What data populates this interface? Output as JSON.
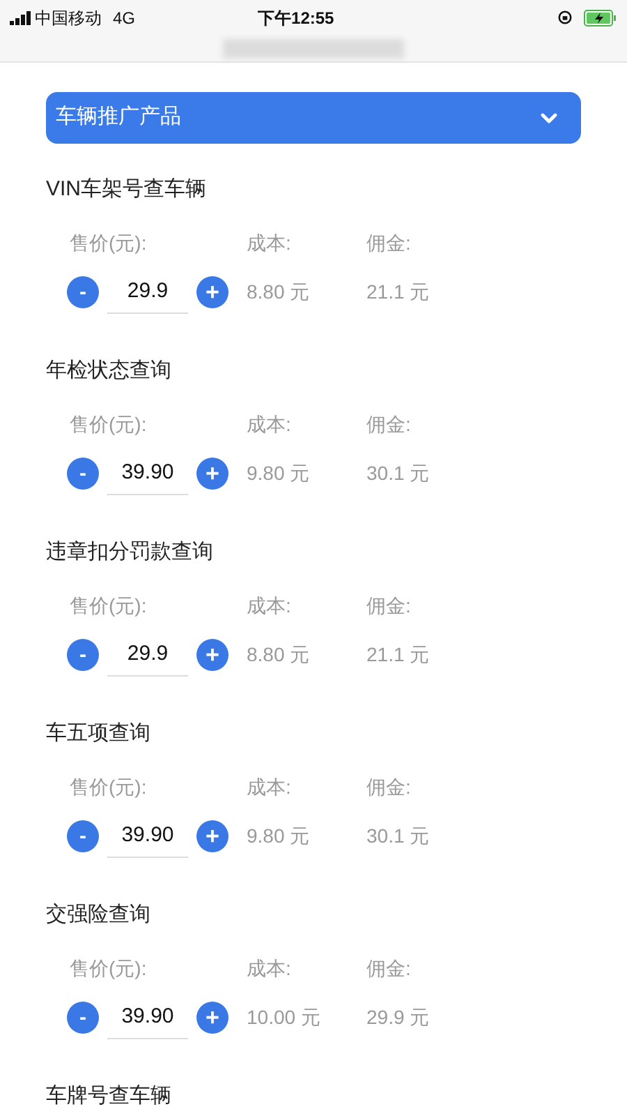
{
  "status_bar": {
    "carrier": "中国移动",
    "network": "4G",
    "time": "下午12:55"
  },
  "category_select": {
    "value": "车辆推广产品"
  },
  "products": [
    {
      "name": "VIN车架号查车辆",
      "price_label": "售价(元):",
      "price": "29.9",
      "cost_label": "成本:",
      "cost": "8.80 元",
      "commission_label": "佣金:",
      "commission": "21.1 元",
      "decrement": "-",
      "increment": "+"
    },
    {
      "name": "年检状态查询",
      "price_label": "售价(元):",
      "price": "39.90",
      "cost_label": "成本:",
      "cost": "9.80 元",
      "commission_label": "佣金:",
      "commission": "30.1 元",
      "decrement": "-",
      "increment": "+"
    },
    {
      "name": "违章扣分罚款查询",
      "price_label": "售价(元):",
      "price": "29.9",
      "cost_label": "成本:",
      "cost": "8.80 元",
      "commission_label": "佣金:",
      "commission": "21.1 元",
      "decrement": "-",
      "increment": "+"
    },
    {
      "name": "车五项查询",
      "price_label": "售价(元):",
      "price": "39.90",
      "cost_label": "成本:",
      "cost": "9.80 元",
      "commission_label": "佣金:",
      "commission": "30.1 元",
      "decrement": "-",
      "increment": "+"
    },
    {
      "name": "交强险查询",
      "price_label": "售价(元):",
      "price": "39.90",
      "cost_label": "成本:",
      "cost": "10.00 元",
      "commission_label": "佣金:",
      "commission": "29.9 元",
      "decrement": "-",
      "increment": "+"
    },
    {
      "name": "车牌号查车辆"
    }
  ]
}
